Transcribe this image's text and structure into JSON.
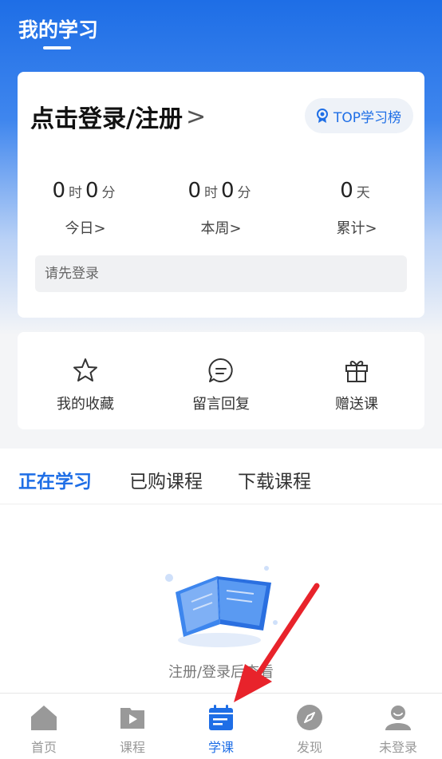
{
  "header": {
    "title": "我的学习"
  },
  "login_card": {
    "login_text": "点击登录/注册",
    "chevron": ">",
    "top_button": "TOP学习榜",
    "stats": [
      {
        "value1": "0",
        "unit1": "时",
        "value2": "0",
        "unit2": "分",
        "label": "今日>"
      },
      {
        "value1": "0",
        "unit1": "时",
        "value2": "0",
        "unit2": "分",
        "label": "本周>"
      },
      {
        "value1": "0",
        "unit1": "天",
        "label": "累计>"
      }
    ],
    "notice": "请先登录"
  },
  "actions": [
    {
      "label": "我的收藏",
      "icon": "star-icon"
    },
    {
      "label": "留言回复",
      "icon": "comment-icon"
    },
    {
      "label": "赠送课",
      "icon": "gift-icon"
    }
  ],
  "tabs": [
    {
      "label": "正在学习",
      "active": true
    },
    {
      "label": "已购课程"
    },
    {
      "label": "下载课程"
    }
  ],
  "empty_state": {
    "text": "注册/登录后查看"
  },
  "bottom_nav": [
    {
      "label": "首页",
      "icon": "home-icon"
    },
    {
      "label": "课程",
      "icon": "play-icon"
    },
    {
      "label": "学课",
      "icon": "calendar-icon",
      "active": true
    },
    {
      "label": "发现",
      "icon": "compass-icon"
    },
    {
      "label": "未登录",
      "icon": "user-icon"
    }
  ],
  "colors": {
    "accent": "#1e6ee6",
    "annotation_arrow": "#e8232b"
  }
}
